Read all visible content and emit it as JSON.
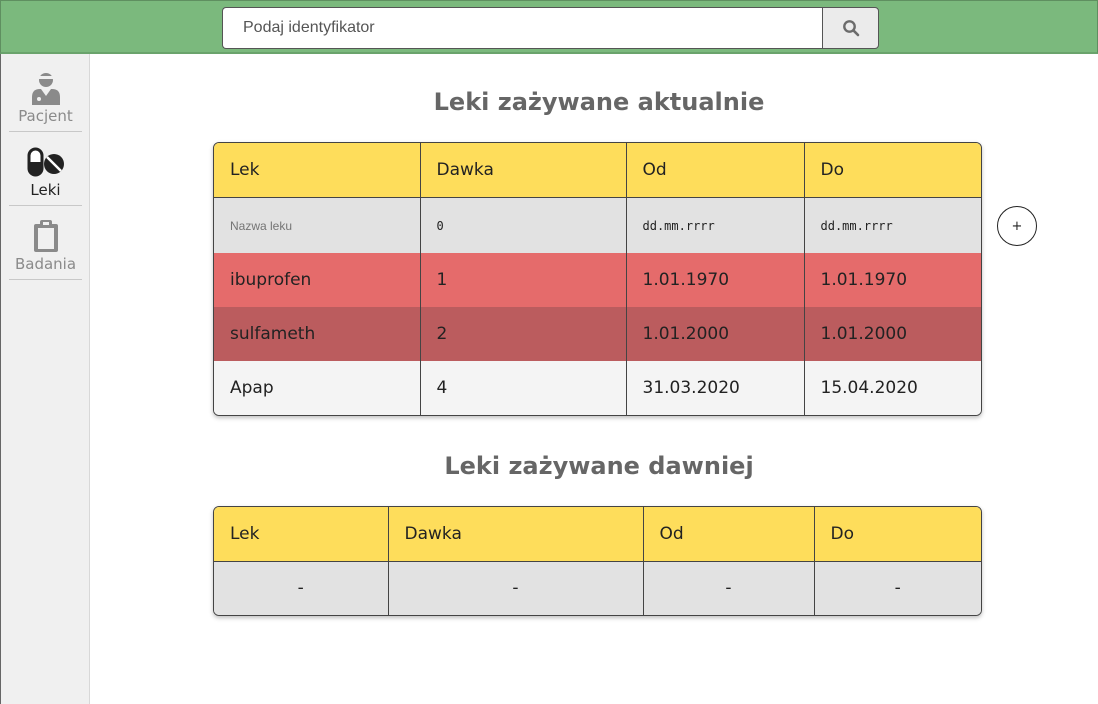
{
  "search": {
    "placeholder": "Podaj identyfikator",
    "icon": "search-icon"
  },
  "sidebar": {
    "items": [
      {
        "label": "Pacjent",
        "icon": "patient-icon",
        "active": false
      },
      {
        "label": "Leki",
        "icon": "pills-icon",
        "active": true
      },
      {
        "label": "Badania",
        "icon": "clipboard-icon",
        "active": false
      }
    ]
  },
  "current": {
    "title": "Leki zażywane aktualnie",
    "headers": [
      "Lek",
      "Dawka",
      "Od",
      "Do"
    ],
    "input_placeholders": {
      "name": "Nazwa leku",
      "dose": "0",
      "from": "dd.mm.rrrr",
      "to": "dd.mm.rrrr"
    },
    "add_button_label": "+",
    "rows": [
      {
        "name": "ibuprofen",
        "dose": "1",
        "from": "1.01.1970",
        "to": "1.01.1970",
        "color": "#e56b6b"
      },
      {
        "name": "sulfameth",
        "dose": "2",
        "from": "1.01.2000",
        "to": "1.01.2000",
        "color": "#bb5c5e"
      },
      {
        "name": "Apap",
        "dose": "4",
        "from": "31.03.2020",
        "to": "15.04.2020",
        "color": "#f4f4f4"
      }
    ]
  },
  "past": {
    "title": "Leki zażywane dawniej",
    "headers": [
      "Lek",
      "Dawka",
      "Od",
      "Do"
    ],
    "rows": [
      {
        "name": "-",
        "dose": "-",
        "from": "-",
        "to": "-"
      }
    ]
  },
  "colors": {
    "topbar": "#7bb97d",
    "header": "#fedd5b",
    "sidebar": "#f0f0f0"
  }
}
